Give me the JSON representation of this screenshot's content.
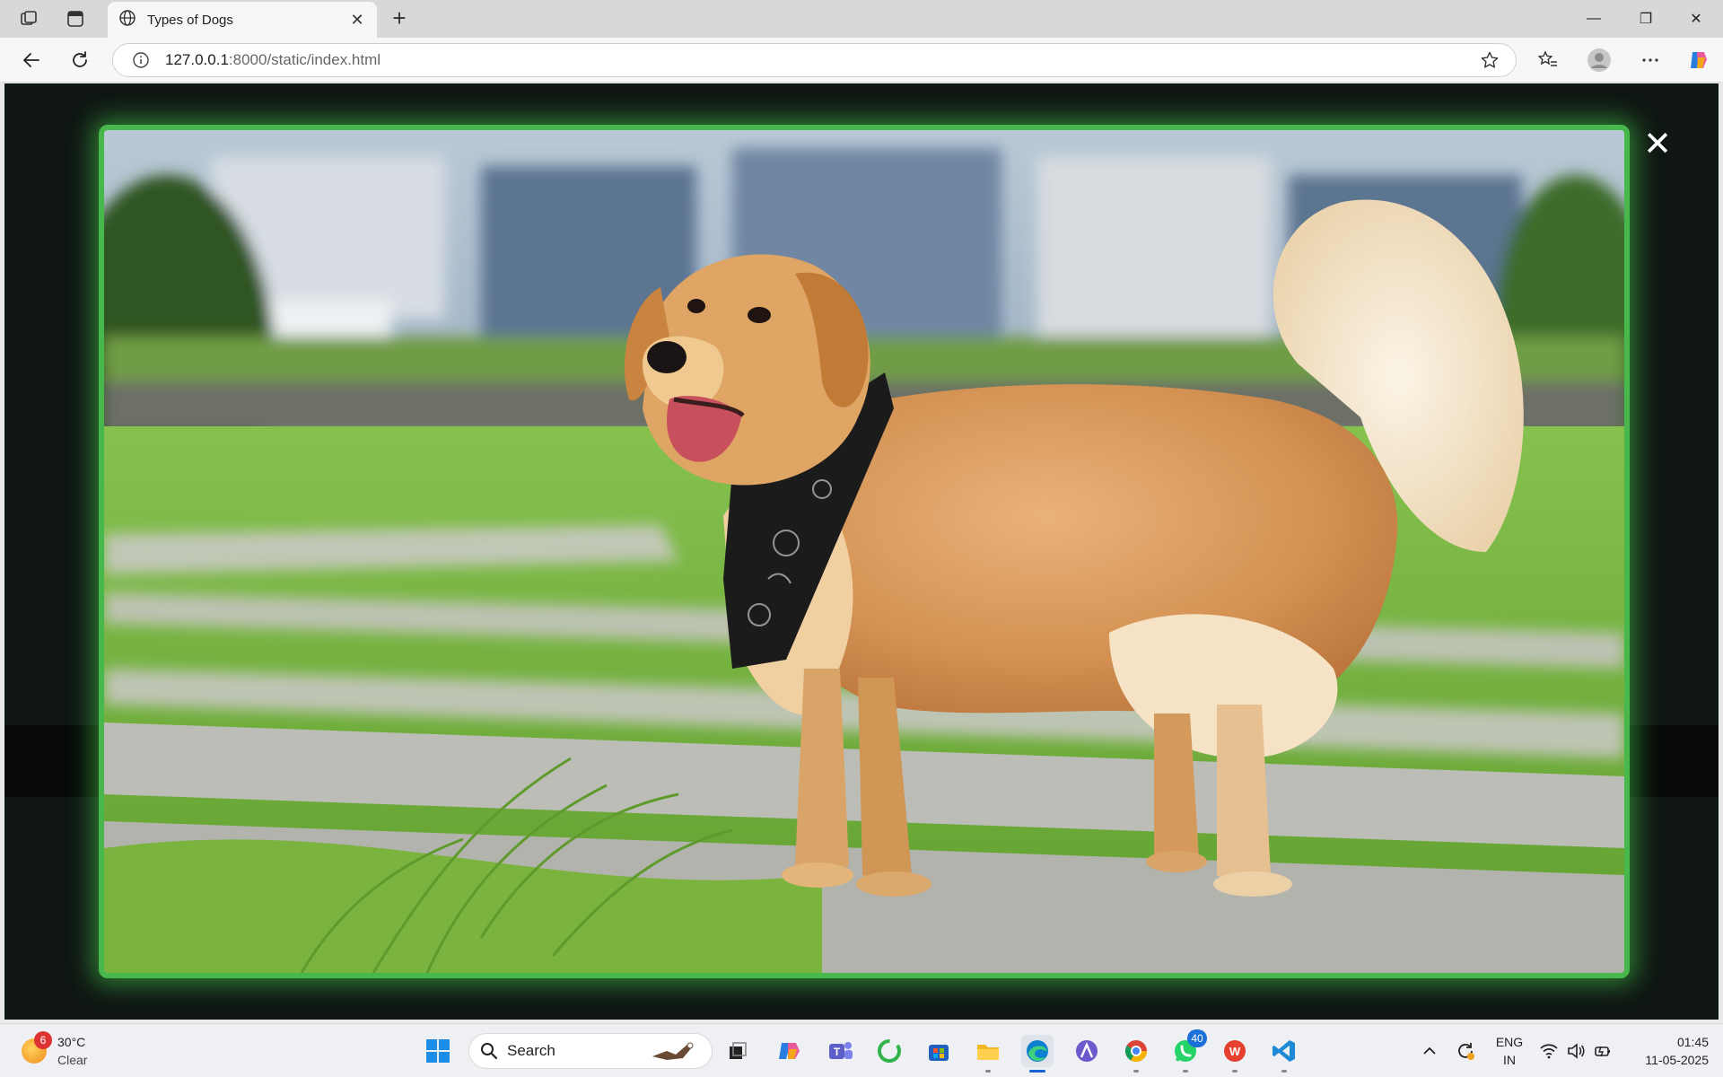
{
  "browser": {
    "tab": {
      "title": "Types of Dogs",
      "close_label": "✕"
    },
    "new_tab_label": "+",
    "url": {
      "host": "127.0.0.1",
      "rest": ":8000/static/index.html"
    },
    "window_controls": {
      "minimize": "—",
      "maximize": "❐",
      "close": "✕"
    }
  },
  "lightbox": {
    "close_label": "✕",
    "image_subject": "golden-retriever-dog-photo",
    "border_color": "#49b84c"
  },
  "taskbar": {
    "weather": {
      "temp": "30°C",
      "condition": "Clear",
      "badge": "6"
    },
    "search_label": "Search",
    "apps": [
      "start",
      "search",
      "task-view",
      "copilot",
      "teams",
      "refresh-app",
      "store",
      "file-explorer",
      "edge",
      "app-a",
      "chrome",
      "whatsapp",
      "wps-office",
      "vscode"
    ],
    "whatsapp_badge": "40",
    "language": {
      "line1": "ENG",
      "line2": "IN"
    },
    "clock": {
      "time": "01:45",
      "date": "11-05-2025"
    }
  }
}
